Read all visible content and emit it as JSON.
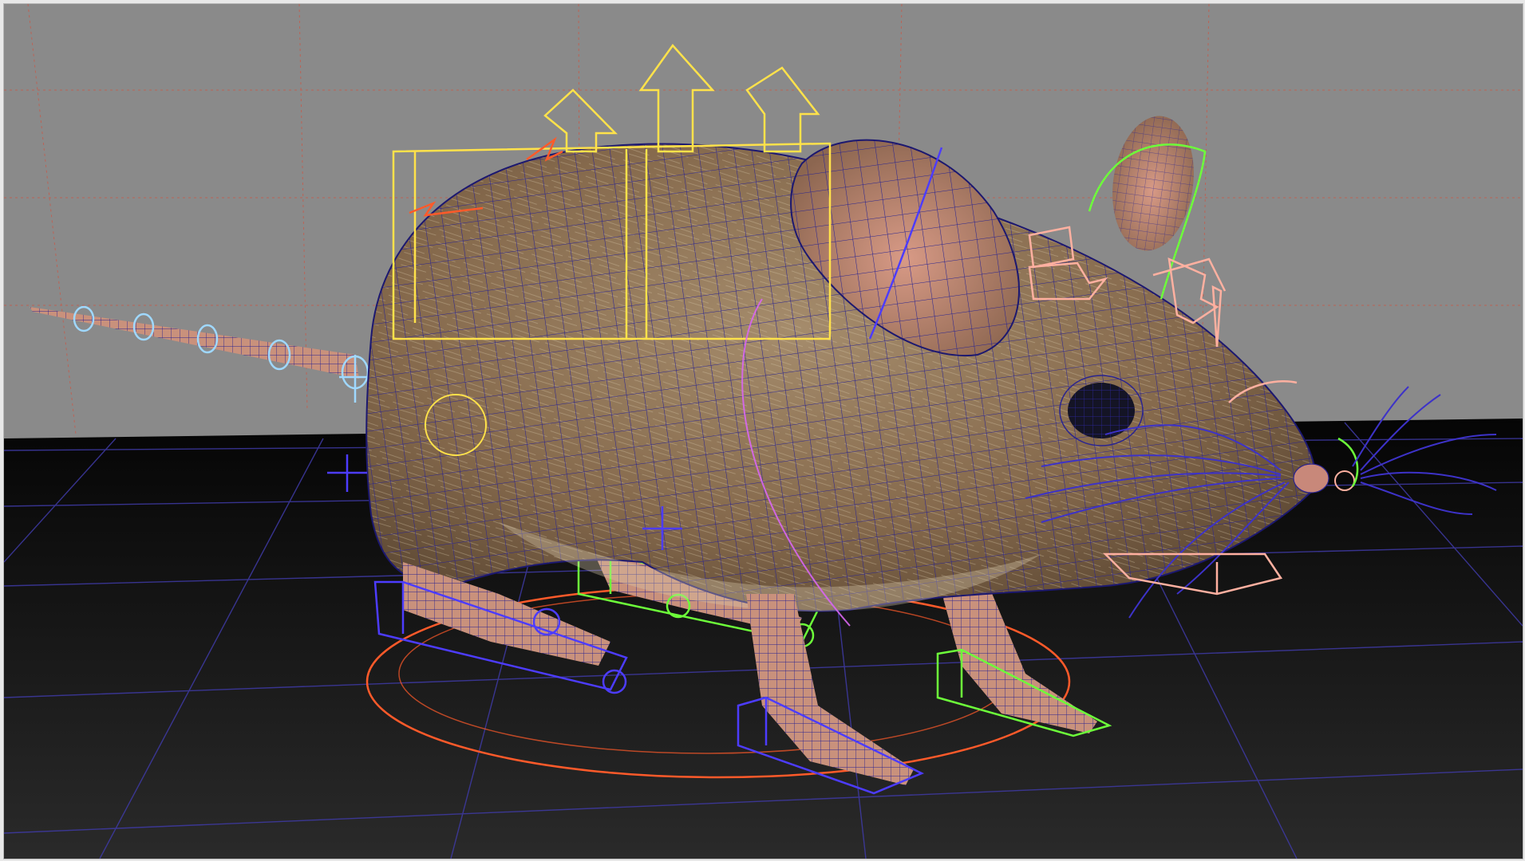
{
  "viewport": {
    "background_color": "#8a8a8a",
    "floor_color": "#141414",
    "grid_color": "#3f3aa6",
    "backdrop_grid_color": "#c75a4a"
  },
  "model": {
    "subject": "mouse",
    "fur_color": "#8b7356",
    "skin_color": "#d39a86",
    "wireframe_color": "#2a2490"
  },
  "rig_controls": {
    "ik_control_color": "#4d3cff",
    "fk_control_color": "#6dff3a",
    "main_control_color": "#ffe24a",
    "face_control_color": "#ffb0a0",
    "tail_control_color": "#9fd8ff",
    "root_circle_color": "#ff5a2a"
  }
}
